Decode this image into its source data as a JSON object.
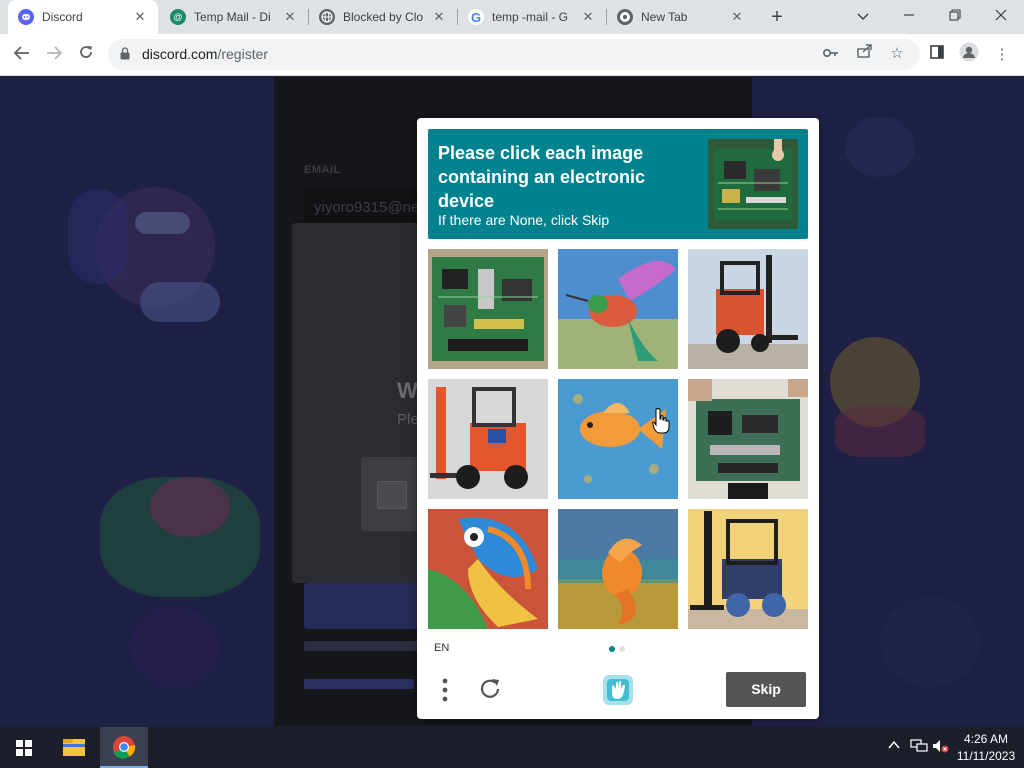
{
  "browser": {
    "tabs": [
      {
        "title": "Discord",
        "favicon": "discord-icon",
        "color": "#5865f2",
        "active": true
      },
      {
        "title": "Temp Mail - Di",
        "favicon": "tempmail-icon",
        "color": "#1b8a6b",
        "active": false
      },
      {
        "title": "Blocked by Clo",
        "favicon": "globe-icon",
        "color": "#5f6368",
        "active": false
      },
      {
        "title": "temp -mail - G",
        "favicon": "google-icon",
        "color": "#4285f4",
        "active": false
      },
      {
        "title": "New Tab",
        "favicon": "chrome-icon",
        "color": "#5f6368",
        "active": false
      }
    ],
    "url_host": "discord.com",
    "url_path": "/register"
  },
  "page": {
    "email_label": "EMAIL",
    "email_value": "yiyoro9315@ne",
    "dialog_title_fragment": "W",
    "dialog_sub_fragment": "Ple"
  },
  "captcha": {
    "prompt_line": "Please click each image containing an electronic device",
    "prompt_sub": "If there are None, click Skip",
    "images": [
      {
        "subject": "circuit-board",
        "selected": false
      },
      {
        "subject": "hummingbird",
        "selected": false
      },
      {
        "subject": "forklift",
        "selected": false
      },
      {
        "subject": "forklift",
        "selected": false
      },
      {
        "subject": "goldfish",
        "selected": false
      },
      {
        "subject": "circuit-board",
        "selected": false
      },
      {
        "subject": "bird",
        "selected": false
      },
      {
        "subject": "goldfish",
        "selected": false
      },
      {
        "subject": "forklift",
        "selected": false
      }
    ],
    "language": "EN",
    "pages_total": 2,
    "page_current": 1,
    "skip_label": "Skip",
    "accent_color": "#00838f"
  },
  "taskbar": {
    "time": "4:26 AM",
    "date": "11/11/2023"
  }
}
